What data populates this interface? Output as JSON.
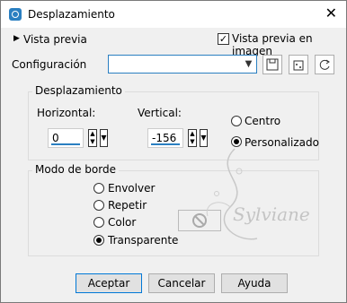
{
  "window": {
    "title": "Desplazamiento",
    "close": "✕"
  },
  "preview": {
    "toggle_label": "Vista previa",
    "checkbox_label": "Vista previa en imagen",
    "checked": true
  },
  "config": {
    "label": "Configuración",
    "value": ""
  },
  "offset": {
    "title": "Desplazamiento",
    "horizontal_label": "Horizontal:",
    "horizontal_value": "0",
    "vertical_label": "Vertical:",
    "vertical_value": "-156",
    "center_label": "Centro",
    "custom_label": "Personalizado",
    "selected": "Personalizado"
  },
  "edge": {
    "title": "Modo de borde",
    "options": [
      "Envolver",
      "Repetir",
      "Color",
      "Transparente"
    ],
    "selected": "Transparente"
  },
  "watermark": {
    "text": "Sylviane"
  },
  "buttons": {
    "ok": "Aceptar",
    "cancel": "Cancelar",
    "help": "Ayuda"
  },
  "colors": {
    "accent": "#2a7fc1",
    "primary_border": "#0078d7"
  }
}
